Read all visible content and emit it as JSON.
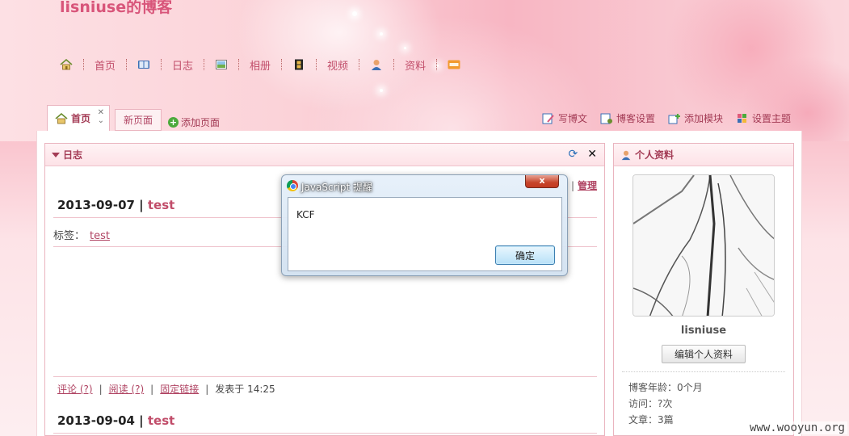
{
  "blog": {
    "title": "lisniuse的博客"
  },
  "nav": {
    "items": [
      {
        "icon": "home-icon",
        "label": ""
      },
      {
        "icon": "book-icon",
        "label": "首页"
      },
      {
        "icon": "picture-icon",
        "label": "日志"
      },
      {
        "icon": "film-icon",
        "label": "相册"
      },
      {
        "icon": "user-icon",
        "label": "视频"
      },
      {
        "icon": "rss-icon",
        "label": "资料"
      }
    ]
  },
  "tabs": {
    "active_label": "首页",
    "new_label": "新页面",
    "add_label": "添加页面"
  },
  "toolbar": {
    "write": "写博文",
    "settings": "博客设置",
    "add_module": "添加模块",
    "theme": "设置主题"
  },
  "diary": {
    "title": "日志",
    "manage": "管理",
    "entries": [
      {
        "date": "2013-09-07",
        "title": "test"
      },
      {
        "date": "2013-09-04",
        "title": "test"
      }
    ],
    "tags_label": "标签：",
    "tag": "test",
    "footer": {
      "comments": "评论 (?)",
      "reads": "阅读 (?)",
      "permalink": "固定链接",
      "posted": "发表于 14:25"
    }
  },
  "profile": {
    "title": "个人资料",
    "username": "lisniuse",
    "edit_button": "编辑个人资料",
    "age": "博客年龄：0个月",
    "visits": "访问：?次",
    "articles": "文章：3篇"
  },
  "dialog": {
    "title": "JavaScript 提醒",
    "message": "KCF",
    "ok": "确定",
    "close": "x"
  },
  "watermark": "www.wooyun.org",
  "colors": {
    "accent": "#c14d6a",
    "border": "#eab4bf"
  }
}
